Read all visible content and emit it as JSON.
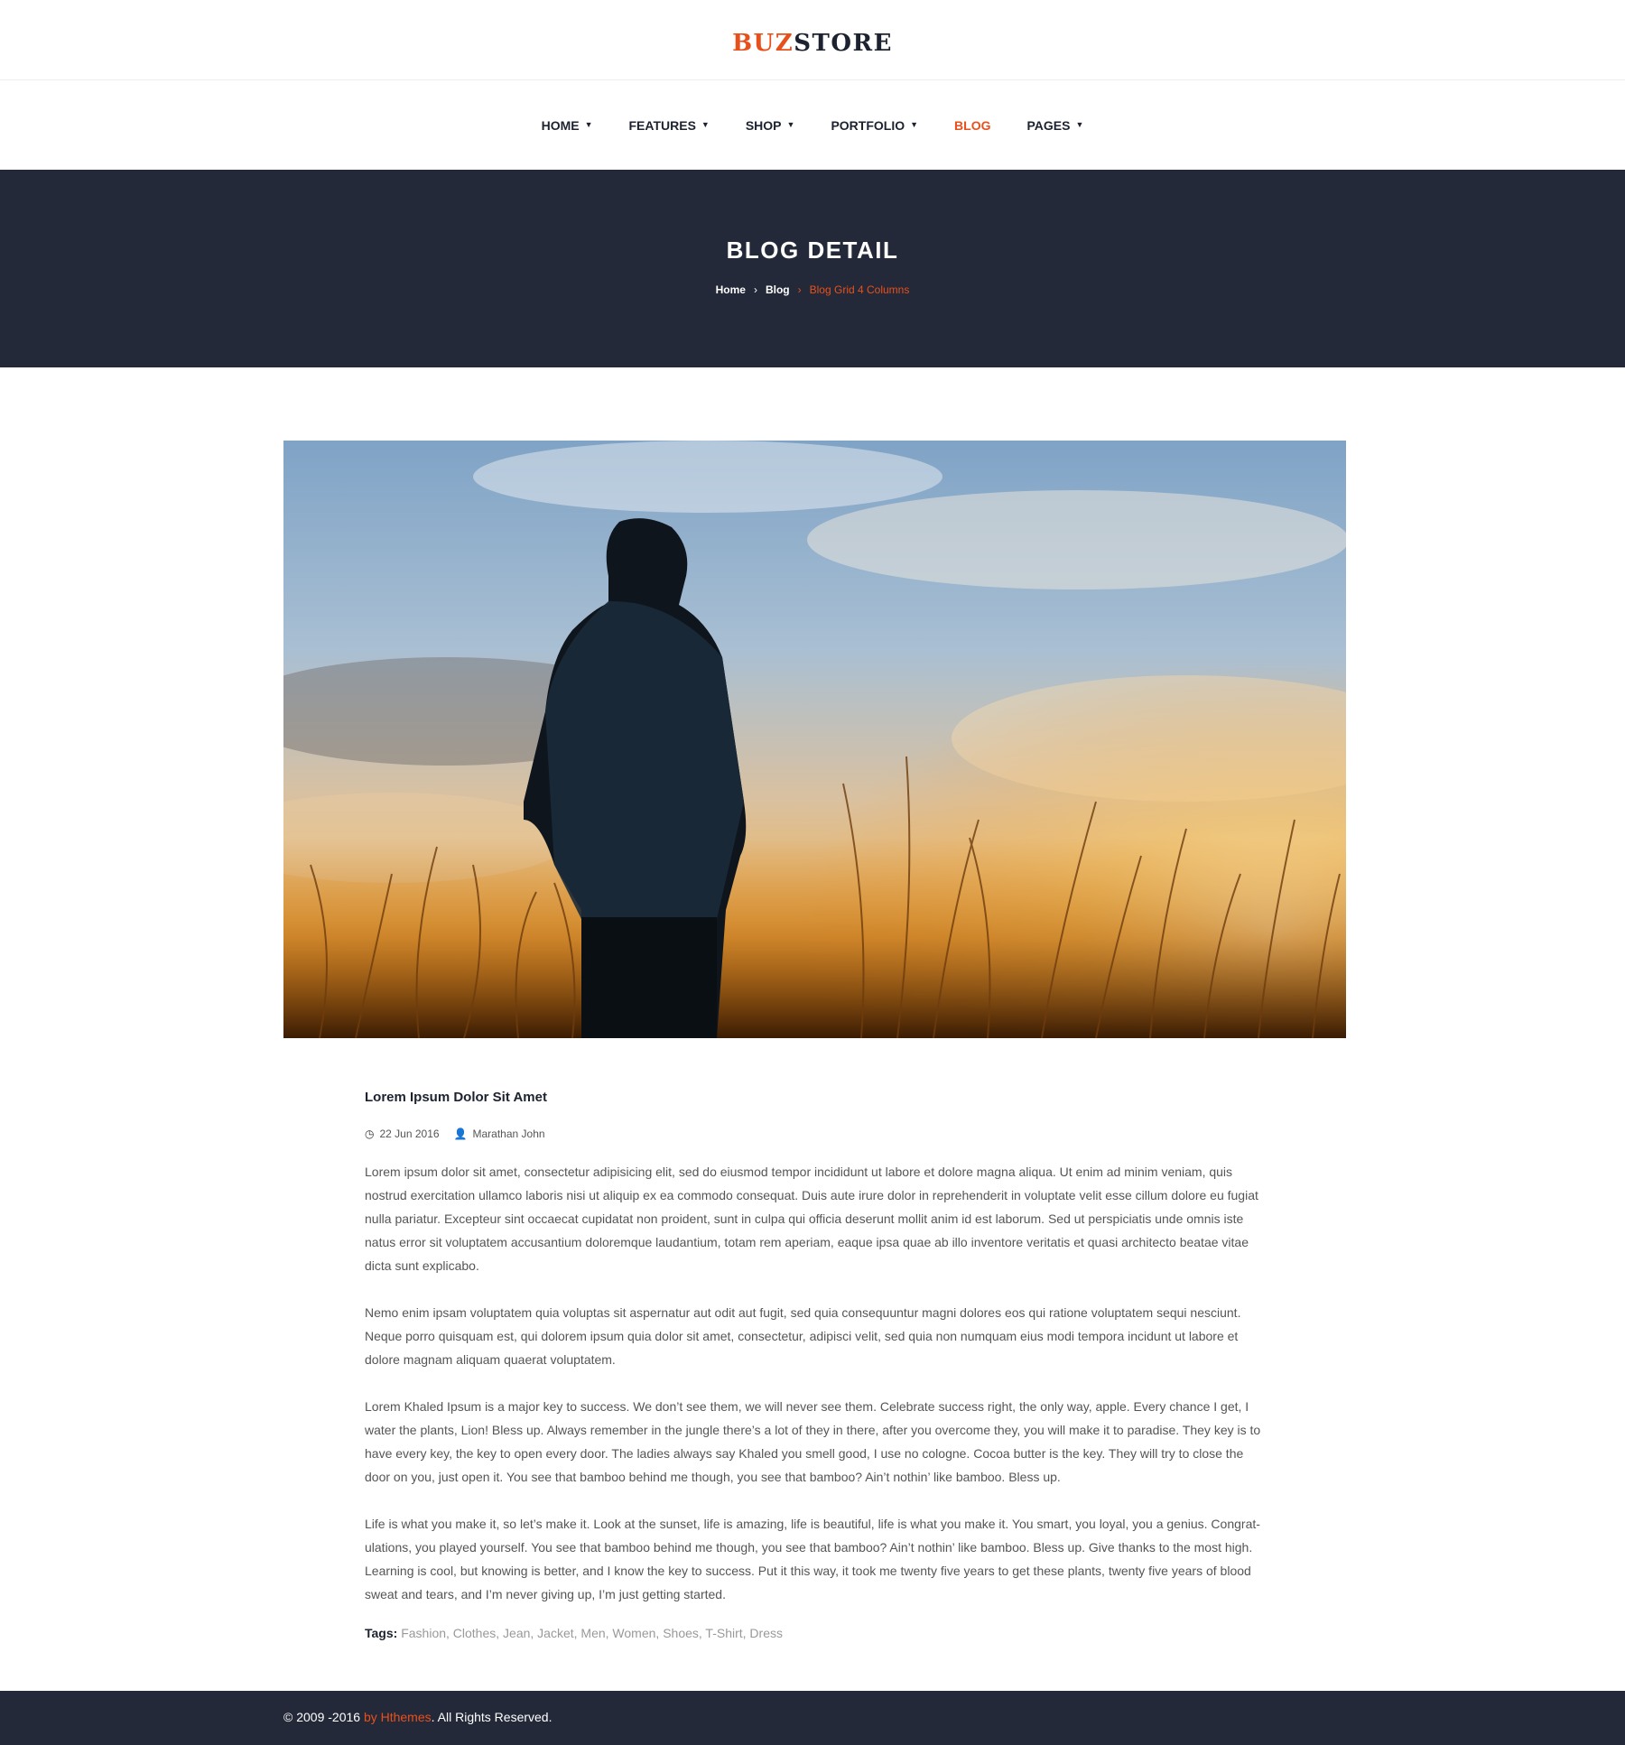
{
  "brand": {
    "accent": "BUZ",
    "rest": "STORE",
    "accent_color": "#e8501b",
    "dark_color": "#1d2230"
  },
  "nav": {
    "items": [
      {
        "label": "HOME",
        "caret": true,
        "active": false
      },
      {
        "label": "FEATURES",
        "caret": true,
        "active": false
      },
      {
        "label": "SHOP",
        "caret": true,
        "active": false
      },
      {
        "label": "PORTFOLIO",
        "caret": true,
        "active": false
      },
      {
        "label": "BLOG",
        "caret": false,
        "active": true
      },
      {
        "label": "PAGES",
        "caret": true,
        "active": false
      }
    ]
  },
  "hero": {
    "title": "BLOG DETAIL",
    "breadcrumb": {
      "home": "Home",
      "blog": "Blog",
      "current": "Blog Grid 4 Columns"
    },
    "background": "#232939"
  },
  "post": {
    "image": "silhouette-at-sunset-in-grass-field",
    "title": "Lorem Ipsum Dolor Sit Amet",
    "date": "22 Jun 2016",
    "author": "Marathan John",
    "paragraphs": [
      "Lorem ipsum dolor sit amet, consectetur adipisicing elit, sed do eiusmod tempor incididunt ut labore et dolore magna aliqua. Ut enim ad minim veniam, quis nostrud exercitation ullamco laboris nisi ut aliquip ex ea commodo consequat. Duis aute irure dolor in reprehenderit in voluptate velit esse cillum dolore eu fugiat nulla pariatur. Excepteur sint occaecat cupidatat non proident, sunt in culpa qui officia deserunt mollit anim id est laborum. Sed ut perspiciatis unde omnis iste natus error sit voluptatem accusantium doloremque laudantium, totam rem aperiam, eaque ipsa quae ab illo inventore veritatis et quasi architecto beatae vitae dicta sunt explicabo.",
      "Nemo enim ipsam voluptatem quia voluptas sit aspernatur aut odit aut fugit, sed quia consequuntur magni dolores eos qui ratione voluptatem sequi nesciunt. Neque porro quisquam est, qui dolorem ipsum quia dolor sit amet, consectetur, adipisci velit, sed quia non numquam eius modi tempora incidunt ut labore et dolore magnam aliquam quaerat voluptatem.",
      "Lorem Khaled Ipsum is a major key to success. We don’t see them, we will never see them. Celebrate success right, the only way, apple. Every chance I get, I water the plants, Lion! Bless up. Always remember in the jungle there’s a lot of they in there, after you overcome they, you will make it to paradise. They key is to have every key, the key to open every door. The ladies always say Khaled you smell good, I use no cologne. Cocoa butter is the key. They will try to close the door on you, just open it. You see that bamboo behind me though, you see that bamboo? Ain’t nothin’ like bamboo. Bless up.",
      "Life is what you make it, so let’s make it. Look at the sunset, life is amazing, life is beautiful, life is what you make it. You smart, you loyal, you a genius. Congrat-ulations, you played yourself. You see that bamboo behind me though, you see that bamboo? Ain’t nothin’ like bamboo. Bless up. Give thanks to the most high. Learning is cool, but knowing is better, and I know the key to success. Put it this way, it took me twenty five years to get these plants, twenty five years of blood sweat and tears, and I’m never giving up, I’m just getting started."
    ],
    "tags_label": "Tags:",
    "tags": "Fashion, Clothes, Jean, Jacket, Men, Women, Shoes, T-Shirt, Dress"
  },
  "footer": {
    "prefix": "© 2009 -2016 ",
    "brand": "by Hthemes",
    "suffix": ". All Rights Reserved."
  }
}
